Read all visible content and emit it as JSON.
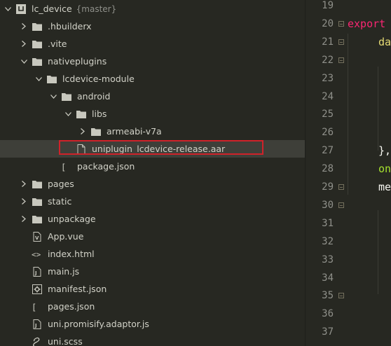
{
  "tree": {
    "rows": [
      {
        "label": "lc_device",
        "extra": "{master}",
        "icon": "project-icon",
        "chev": "down",
        "indent": 0
      },
      {
        "label": ".hbuilderx",
        "icon": "folder-icon",
        "chev": "right",
        "indent": 1
      },
      {
        "label": ".vite",
        "icon": "folder-icon",
        "chev": "right",
        "indent": 1
      },
      {
        "label": "nativeplugins",
        "icon": "folder-icon",
        "chev": "down",
        "indent": 1
      },
      {
        "label": "lcdevice-module",
        "icon": "folder-icon",
        "chev": "down",
        "indent": 2
      },
      {
        "label": "android",
        "icon": "folder-icon",
        "chev": "down",
        "indent": 3
      },
      {
        "label": "libs",
        "icon": "folder-icon",
        "chev": "down",
        "indent": 4
      },
      {
        "label": "armeabi-v7a",
        "icon": "folder-icon",
        "chev": "right",
        "indent": 5
      },
      {
        "label": "uniplugin_lcdevice-release.aar",
        "icon": "file-icon",
        "chev": "none",
        "indent": 4,
        "selected": true
      },
      {
        "label": "package.json",
        "icon": "json-icon",
        "chev": "none",
        "indent": 3
      },
      {
        "label": "pages",
        "icon": "folder-icon",
        "chev": "right",
        "indent": 1
      },
      {
        "label": "static",
        "icon": "folder-icon",
        "chev": "right",
        "indent": 1
      },
      {
        "label": "unpackage",
        "icon": "folder-icon",
        "chev": "right",
        "indent": 1
      },
      {
        "label": "App.vue",
        "icon": "vue-file-icon",
        "chev": "none",
        "indent": 1
      },
      {
        "label": "index.html",
        "icon": "html-file-icon",
        "chev": "none",
        "indent": 1
      },
      {
        "label": "main.js",
        "icon": "js-file-icon",
        "chev": "none",
        "indent": 1
      },
      {
        "label": "manifest.json",
        "icon": "manifest-icon",
        "chev": "none",
        "indent": 1
      },
      {
        "label": "pages.json",
        "icon": "json-icon",
        "chev": "none",
        "indent": 1
      },
      {
        "label": "uni.promisify.adaptor.js",
        "icon": "js-file-icon",
        "chev": "none",
        "indent": 1
      },
      {
        "label": "uni.scss",
        "icon": "scss-file-icon",
        "chev": "none",
        "indent": 1
      }
    ]
  },
  "editor": {
    "lines": [
      {
        "num": "19",
        "text": "",
        "fold": false
      },
      {
        "num": "20",
        "text": "export",
        "fold": true,
        "indent": 0,
        "color": "#f92672"
      },
      {
        "num": "21",
        "text": "da",
        "fold": true,
        "indent": 1,
        "color": "#e6db74"
      },
      {
        "num": "22",
        "text": "",
        "fold": true
      },
      {
        "num": "23",
        "text": "",
        "fold": false
      },
      {
        "num": "24",
        "text": "",
        "fold": false
      },
      {
        "num": "25",
        "text": "",
        "fold": false
      },
      {
        "num": "26",
        "text": "",
        "fold": false
      },
      {
        "num": "27",
        "text": "},",
        "fold": false,
        "indent": 1,
        "color": "#f8f8f2"
      },
      {
        "num": "28",
        "text": "on",
        "fold": false,
        "indent": 1,
        "color": "#a6e22e"
      },
      {
        "num": "29",
        "text": "me",
        "fold": true,
        "indent": 1,
        "color": "#f8f8f2"
      },
      {
        "num": "30",
        "text": "",
        "fold": true
      },
      {
        "num": "31",
        "text": "",
        "fold": false
      },
      {
        "num": "32",
        "text": "",
        "fold": false
      },
      {
        "num": "33",
        "text": "",
        "fold": false
      },
      {
        "num": "34",
        "text": "",
        "fold": false
      },
      {
        "num": "35",
        "text": "",
        "fold": true
      },
      {
        "num": "36",
        "text": "",
        "fold": false
      },
      {
        "num": "37",
        "text": "",
        "fold": false
      }
    ]
  }
}
